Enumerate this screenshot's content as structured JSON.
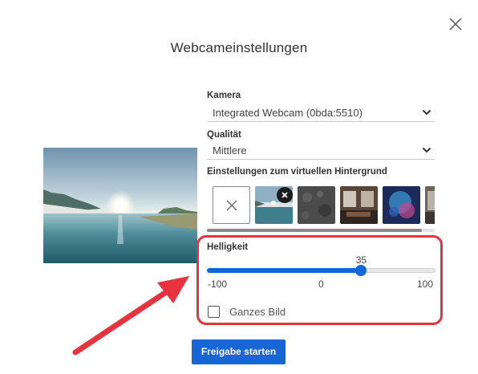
{
  "dialog": {
    "title": "Webcameinstellungen",
    "close_icon": "close-icon"
  },
  "camera": {
    "label": "Kamera",
    "value": "Integrated Webcam (0bda:5510)"
  },
  "quality": {
    "label": "Qualität",
    "value": "Mittlere"
  },
  "virtual_background": {
    "label": "Einstellungen zum virtuellen Hintergrund",
    "tiles": [
      {
        "name": "none",
        "icon": "x-icon"
      },
      {
        "name": "lake-landscape",
        "selected": true
      },
      {
        "name": "gray-texture"
      },
      {
        "name": "room-interior"
      },
      {
        "name": "blue-bokeh"
      },
      {
        "name": "room-interior-2"
      }
    ]
  },
  "brightness": {
    "label": "Helligkeit",
    "value": 35,
    "value_label": "35",
    "min": -100,
    "max": 100,
    "min_label": "-100",
    "mid_label": "0",
    "max_label": "100"
  },
  "whole_image": {
    "label": "Ganzes Bild",
    "checked": false
  },
  "actions": {
    "start_label": "Freigabe starten"
  },
  "colors": {
    "accent": "#1866d6",
    "annotation": "#e8333f"
  }
}
